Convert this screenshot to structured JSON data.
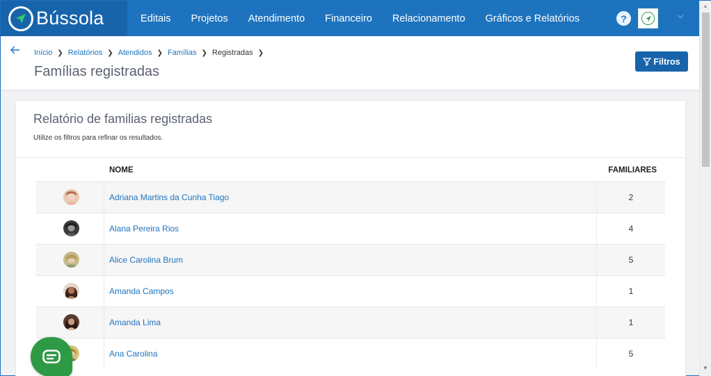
{
  "brand": {
    "name": "Bússola"
  },
  "nav": {
    "items": [
      "Editais",
      "Projetos",
      "Atendimento",
      "Financeiro",
      "Relacionamento",
      "Gráficos e Relatórios"
    ]
  },
  "breadcrumb": [
    "Início",
    "Relatórios",
    "Atendidos",
    "Famílias",
    "Registradas"
  ],
  "page": {
    "title": "Famílias registradas"
  },
  "filter_button": {
    "label": "Filtros"
  },
  "report": {
    "title": "Relatório de familias registradas",
    "subtitle": "Utilize os filtros para refinar os resultados.",
    "columns": {
      "name": "NOME",
      "familiares": "FAMILIARES"
    },
    "rows": [
      {
        "name": "Adriana Martins da Cunha Tiago",
        "familiares": "2"
      },
      {
        "name": "Alana Pereira Rios",
        "familiares": "4"
      },
      {
        "name": "Alice Carolina Brum",
        "familiares": "5"
      },
      {
        "name": "Amanda Campos",
        "familiares": "1"
      },
      {
        "name": "Amanda Lima",
        "familiares": "1"
      },
      {
        "name": "Ana Carolina",
        "familiares": "5"
      }
    ]
  },
  "colors": {
    "primary": "#1e73be",
    "brand_dark": "#1864ab",
    "chat": "#2f9a45"
  }
}
